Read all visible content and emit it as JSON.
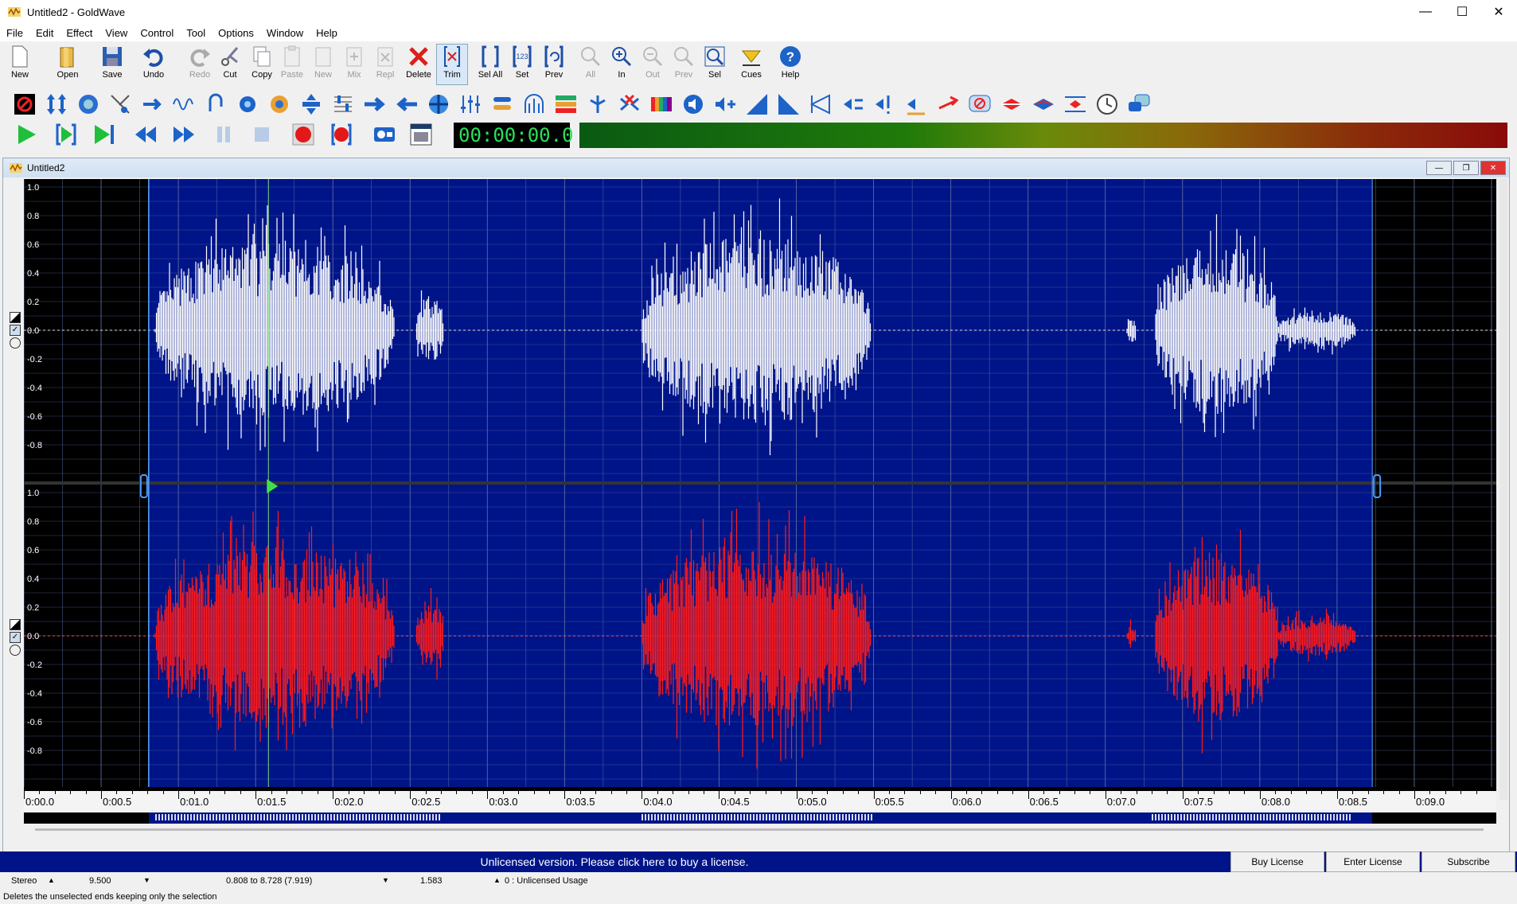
{
  "window": {
    "title": "Untitled2 - GoldWave"
  },
  "menu": [
    "File",
    "Edit",
    "Effect",
    "View",
    "Control",
    "Tool",
    "Options",
    "Window",
    "Help"
  ],
  "toolbar": {
    "new": "New",
    "open": "Open",
    "save": "Save",
    "undo": "Undo",
    "redo": "Redo",
    "cut": "Cut",
    "copy": "Copy",
    "paste": "Paste",
    "new2": "New",
    "mix": "Mix",
    "repl": "Repl",
    "delete": "Delete",
    "trim": "Trim",
    "sel_all": "Sel All",
    "set": "Set",
    "prev": "Prev",
    "all": "All",
    "in": "In",
    "out": "Out",
    "prev2": "Prev",
    "sel": "Sel",
    "cues": "Cues",
    "help": "Help"
  },
  "transport": {
    "time": "00:00:00.0"
  },
  "document": {
    "title": "Untitled2"
  },
  "waveform": {
    "y_ticks": [
      "1.0",
      "0.8",
      "0.6",
      "0.4",
      "0.2",
      "0.0",
      "-0.2",
      "-0.4",
      "-0.6",
      "-0.8"
    ],
    "time_ticks": [
      "0:00.0",
      "0:00.5",
      "0:01.0",
      "0:01.5",
      "0:02.0",
      "0:02.5",
      "0:03.0",
      "0:03.5",
      "0:04.0",
      "0:04.5",
      "0:05.0",
      "0:05.5",
      "0:06.0",
      "0:06.5",
      "0:07.0",
      "0:07.5",
      "0:08.0",
      "0:08.5",
      "0:09.0"
    ],
    "selection_start": 0.808,
    "selection_end": 8.728,
    "cursor": 1.583,
    "view_duration": 9.5,
    "left_color": "#ffffff",
    "right_color": "#ff1a1a",
    "bg_selected": "#001489",
    "bg_unselected": "#000000"
  },
  "license_bar": {
    "message": "Unlicensed version. Please click here to buy a license.",
    "buy": "Buy License",
    "enter": "Enter License",
    "subscribe": "Subscribe"
  },
  "status": {
    "channels": "Stereo",
    "length": "9.500",
    "selection": "0.808 to 8.728 (7.919)",
    "position": "1.583",
    "usage": "0 : Unlicensed Usage",
    "hint": "Deletes the unselected ends keeping only the selection"
  }
}
